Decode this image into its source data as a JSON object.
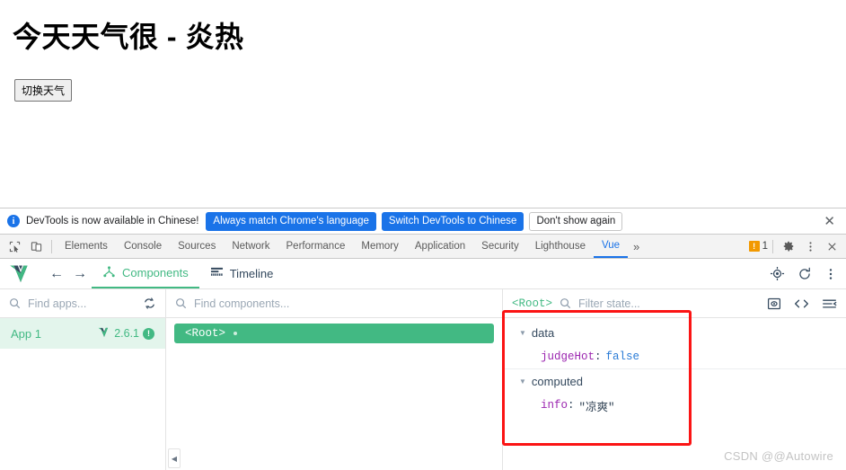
{
  "page": {
    "heading": "今天天气很 - 炎热",
    "toggle_button": "切换天气"
  },
  "notification": {
    "icon": "info-icon",
    "message": "DevTools is now available in Chinese!",
    "primary_button_1": "Always match Chrome's language",
    "primary_button_2": "Switch DevTools to Chinese",
    "ghost_button": "Don't show again",
    "close": "✕",
    "primary_color": "#1a73e8"
  },
  "devtools_tabs": {
    "items": [
      {
        "label": "Elements",
        "active": false
      },
      {
        "label": "Console",
        "active": false
      },
      {
        "label": "Sources",
        "active": false
      },
      {
        "label": "Network",
        "active": false
      },
      {
        "label": "Performance",
        "active": false
      },
      {
        "label": "Memory",
        "active": false
      },
      {
        "label": "Application",
        "active": false
      },
      {
        "label": "Security",
        "active": false
      },
      {
        "label": "Lighthouse",
        "active": false
      },
      {
        "label": "Vue",
        "active": true
      }
    ],
    "overflow": "»",
    "warning_count": "1",
    "warning_color": "#f29900",
    "active_color": "#1a73e8",
    "settings_icon": "gear-icon",
    "menu_icon": "kebab-menu-icon",
    "close_icon": "close-icon",
    "inspect_icon": "inspect-element-icon",
    "device_icon": "device-toolbar-icon"
  },
  "vue_toolbar": {
    "logo": "vue-logo-icon",
    "back": "←",
    "forward": "→",
    "tabs": [
      {
        "label": "Components",
        "icon": "components-tree-icon",
        "active": true
      },
      {
        "label": "Timeline",
        "icon": "timeline-icon",
        "active": false
      }
    ],
    "target_icon": "select-component-icon",
    "refresh_icon": "refresh-icon",
    "menu_icon": "kebab-menu-icon",
    "accent_color": "#42b983"
  },
  "apps_pane": {
    "search_placeholder": "Find apps...",
    "refresh_icon": "refresh-apps-icon",
    "app": {
      "name": "App 1",
      "version": "2.6.1",
      "vue_icon": "vue-logo-icon",
      "badge": "!",
      "selected": true
    }
  },
  "components_pane": {
    "search_placeholder": "Find components...",
    "tree": [
      {
        "label": "<Root>",
        "selected": true,
        "has_dot": true
      }
    ],
    "collapse_handle": "◀"
  },
  "inspector_pane": {
    "root_label": "<Root>",
    "filter_placeholder": "Filter state...",
    "icons": [
      "inspect-dom-icon",
      "open-in-editor-icon",
      "collapse-all-icon"
    ],
    "groups": [
      {
        "name": "data",
        "expanded": true,
        "caret": "▼",
        "rows": [
          {
            "key": "judgeHot",
            "value": "false",
            "type": "bool"
          }
        ]
      },
      {
        "name": "computed",
        "expanded": true,
        "caret": "▼",
        "rows": [
          {
            "key": "info",
            "value": "\"凉爽\"",
            "type": "string"
          }
        ]
      }
    ]
  },
  "annotation": {
    "color": "#fb1414",
    "shape": "rectangle"
  },
  "watermark": "CSDN @@Autowire"
}
